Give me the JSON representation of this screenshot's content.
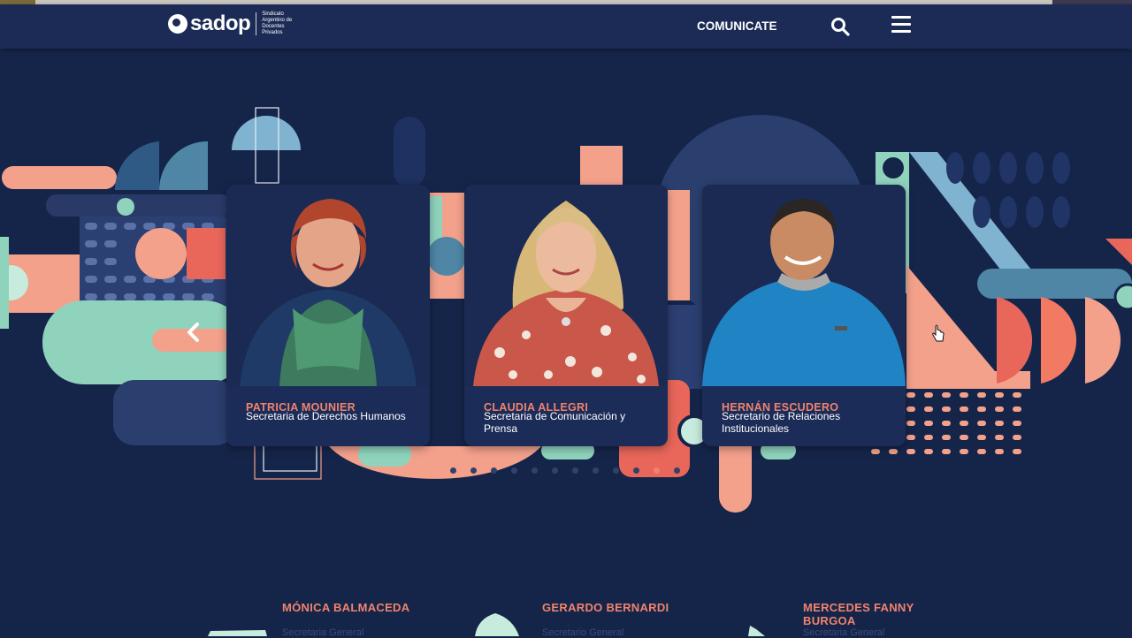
{
  "header": {
    "logo_text": "sadop",
    "logo_sub": "Sindicato Argentino de Docentes Privados",
    "cta_label": "COMUNICATE",
    "search_icon": "search-icon",
    "menu_icon": "hamburger-menu-icon"
  },
  "carousel": {
    "cards": [
      {
        "name": "PATRICIA MOUNIER",
        "role": "Secretaria de Derechos Humanos"
      },
      {
        "name": "CLAUDIA ALLEGRI",
        "role": "Secretaria de Comunicación y Prensa"
      },
      {
        "name": "HERNÁN ESCUDERO",
        "role": "Secretario de Relaciones Institucionales"
      }
    ],
    "dots_total": 12,
    "active_dot": 10,
    "prev_icon": "chevron-left-icon"
  },
  "lower": [
    {
      "name": "MÓNICA BALMACEDA",
      "role": "Secretaria General"
    },
    {
      "name": "GERARDO BERNARDI",
      "role": "Secretario General"
    },
    {
      "name": "MERCEDES FANNY BURGOA",
      "role": "Secretaria General"
    }
  ],
  "colors": {
    "background": "#15254a",
    "header": "#1b2b55",
    "accent": "#f0836c",
    "mint": "#8fd3bd",
    "steel": "#4f86a6"
  }
}
